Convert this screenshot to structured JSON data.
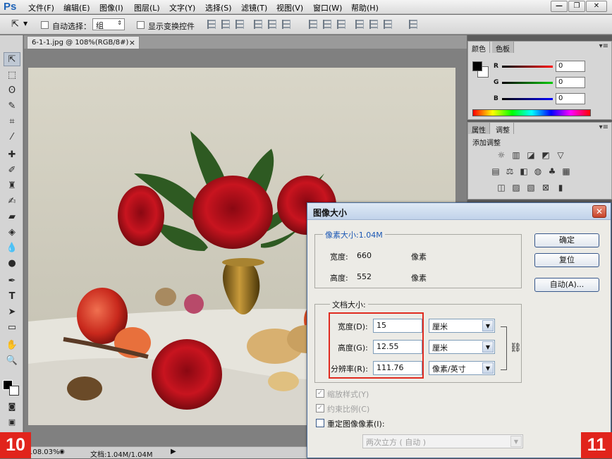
{
  "menubar": {
    "logo": "Ps",
    "items": [
      "文件(F)",
      "编辑(E)",
      "图像(I)",
      "图层(L)",
      "文字(Y)",
      "选择(S)",
      "滤镜(T)",
      "视图(V)",
      "窗口(W)",
      "帮助(H)"
    ],
    "window_buttons": [
      "—",
      "❐",
      "✕"
    ]
  },
  "options_bar": {
    "tool_icon": "move-tool-icon",
    "auto_select_label": "自动选择：",
    "auto_select_value": "组",
    "show_transform_label": "显示变换控件"
  },
  "document": {
    "tab_title": "6-1-1.jpg @ 108%(RGB/8#)",
    "tab_close": "×",
    "zoom": "108.03%",
    "doc_size": "文档:1.04M/1.04M"
  },
  "step_badges": {
    "left": "10",
    "right": "11"
  },
  "color_panel": {
    "tabs": [
      "颜色",
      "色板"
    ],
    "channels": [
      {
        "label": "R",
        "value": "0",
        "color": "#e02020"
      },
      {
        "label": "G",
        "value": "0",
        "color": "#20b020"
      },
      {
        "label": "B",
        "value": "0",
        "color": "#2030d0"
      }
    ]
  },
  "adjust_panel": {
    "tabs": [
      "属性",
      "调整"
    ],
    "heading": "添加调整"
  },
  "dialog": {
    "title": "图像大小",
    "close": "✕",
    "pixel_dims_label": "像素大小:1.04M",
    "width_label": "宽度:",
    "width_value": "660",
    "width_unit": "像素",
    "height_label": "高度:",
    "height_value": "552",
    "height_unit": "像素",
    "doc_size_label": "文档大小:",
    "doc_width_label": "宽度(D):",
    "doc_width_value": "15",
    "doc_width_unit": "厘米",
    "doc_height_label": "高度(G):",
    "doc_height_value": "12.55",
    "doc_height_unit": "厘米",
    "resolution_label": "分辨率(R):",
    "resolution_value": "111.76",
    "resolution_unit": "像素/英寸",
    "ok_label": "确定",
    "reset_label": "复位",
    "auto_label": "自动(A)...",
    "scale_styles_label": "缩放样式(Y)",
    "constrain_label": "约束比例(C)",
    "resample_label": "重定图像像素(I):",
    "resample_method": "两次立方 ( 自动 )"
  }
}
